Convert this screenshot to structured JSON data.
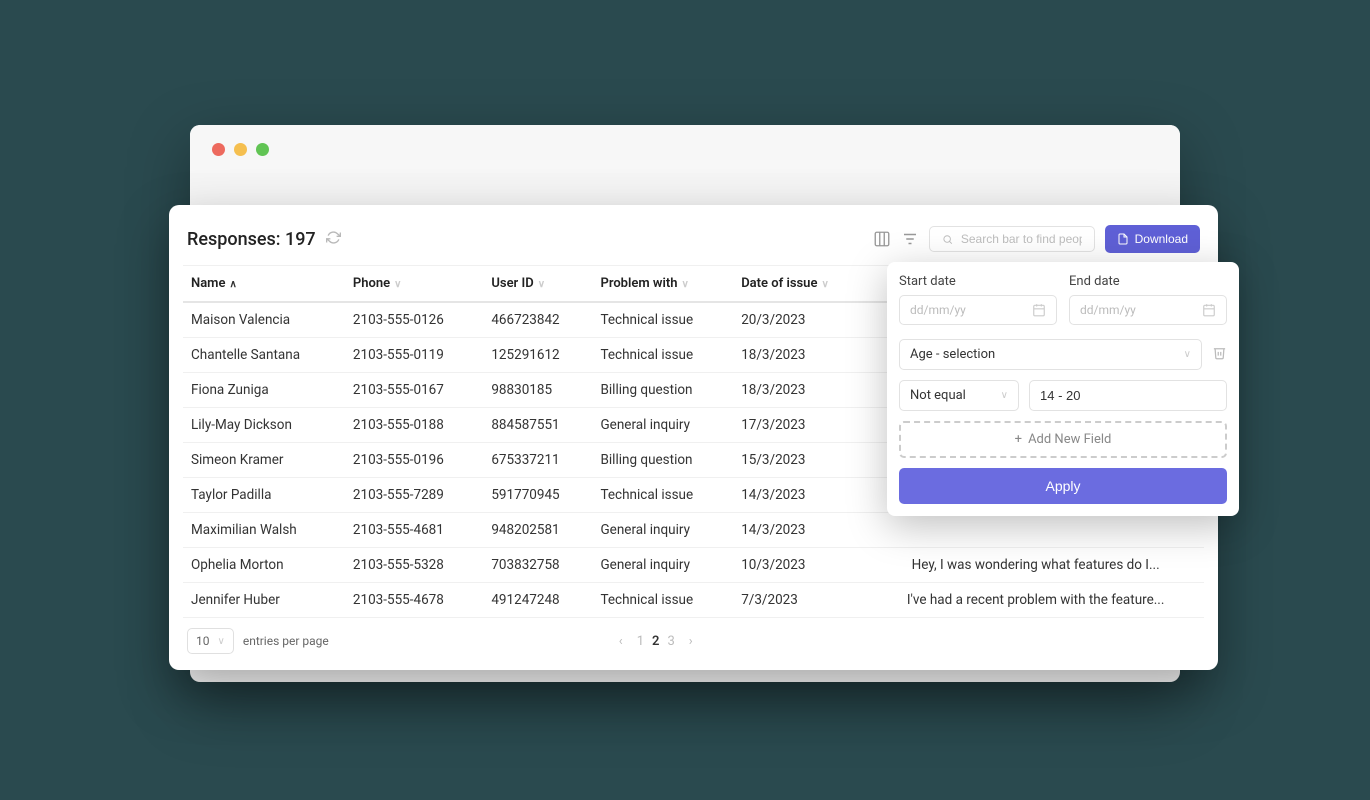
{
  "header": {
    "title": "Responses: 197",
    "search_placeholder": "Search bar to find people",
    "download_label": "Download"
  },
  "columns": {
    "name": "Name",
    "phone": "Phone",
    "user_id": "User ID",
    "problem": "Problem with",
    "date": "Date of issue"
  },
  "rows": [
    {
      "name": "Maison Valencia",
      "phone": "2103-555-0126",
      "user_id": "466723842",
      "problem": "Technical issue",
      "date": "20/3/2023",
      "desc": ""
    },
    {
      "name": "Chantelle Santana",
      "phone": "2103-555-0119",
      "user_id": "125291612",
      "problem": "Technical issue",
      "date": "18/3/2023",
      "desc": ""
    },
    {
      "name": "Fiona Zuniga",
      "phone": "2103-555-0167",
      "user_id": "98830185",
      "problem": "Billing question",
      "date": "18/3/2023",
      "desc": ""
    },
    {
      "name": "Lily-May Dickson",
      "phone": "2103-555-0188",
      "user_id": "884587551",
      "problem": "General inquiry",
      "date": "17/3/2023",
      "desc": ""
    },
    {
      "name": "Simeon Kramer",
      "phone": "2103-555-0196",
      "user_id": "675337211",
      "problem": "Billing question",
      "date": "15/3/2023",
      "desc": ""
    },
    {
      "name": "Taylor Padilla",
      "phone": "2103-555-7289",
      "user_id": "591770945",
      "problem": "Technical issue",
      "date": "14/3/2023",
      "desc": ""
    },
    {
      "name": "Maximilian Walsh",
      "phone": "2103-555-4681",
      "user_id": "948202581",
      "problem": "General inquiry",
      "date": "14/3/2023",
      "desc": ""
    },
    {
      "name": "Ophelia Morton",
      "phone": "2103-555-5328",
      "user_id": "703832758",
      "problem": "General inquiry",
      "date": "10/3/2023",
      "desc": "Hey, I was wondering what features do I..."
    },
    {
      "name": "Jennifer Huber",
      "phone": "2103-555-4678",
      "user_id": "491247248",
      "problem": "Technical issue",
      "date": "7/3/2023",
      "desc": "I've had a recent problem with the feature..."
    }
  ],
  "pagination": {
    "entries_value": "10",
    "entries_label": "entries per page",
    "pages": [
      "1",
      "2",
      "3"
    ],
    "current": "2"
  },
  "filter": {
    "start_label": "Start date",
    "end_label": "End date",
    "date_placeholder": "dd/mm/yy",
    "field_select": "Age - selection",
    "operator": "Not equal",
    "value": "14 - 20",
    "add_field": "Add New Field",
    "apply": "Apply"
  }
}
